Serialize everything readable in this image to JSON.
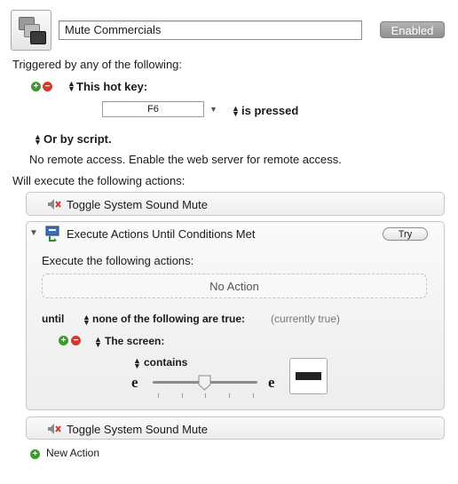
{
  "macro": {
    "name": "Mute Commercials",
    "enabled_label": "Enabled"
  },
  "triggers": {
    "heading": "Triggered by any of the following:",
    "hotkey_label": "This hot key:",
    "hotkey_value": "F6",
    "hotkey_condition": "is pressed",
    "script_label": "Or by script.",
    "remote_text": "No remote access.  Enable the web server for remote access."
  },
  "actions": {
    "heading": "Will execute the following actions:",
    "items": [
      {
        "label": "Toggle System Sound Mute"
      },
      {
        "label": "Execute Actions Until Conditions Met"
      },
      {
        "label": "Toggle System Sound Mute"
      }
    ]
  },
  "until_block": {
    "try_label": "Try",
    "execute_label": "Execute the following actions:",
    "no_action": "No Action",
    "until_label": "until",
    "condition_mode": "none of the following are true:",
    "condition_state": "(currently true)",
    "condition_label": "The screen:",
    "match_mode": "contains",
    "slider_min": "e",
    "slider_max": "e",
    "slider_level": 0.5
  },
  "footer": {
    "new_action_label": "New Action"
  },
  "colors": {
    "add": "#3c9a2c",
    "remove": "#d23a2f",
    "enabled_bg": "#9d9d9d"
  },
  "icons": [
    "macro-group-icon",
    "add-icon",
    "remove-icon",
    "speaker-mute-icon",
    "disclosure-triangle-icon",
    "execute-actions-icon",
    "popup-arrows-icon",
    "dropdown-arrow-icon"
  ]
}
